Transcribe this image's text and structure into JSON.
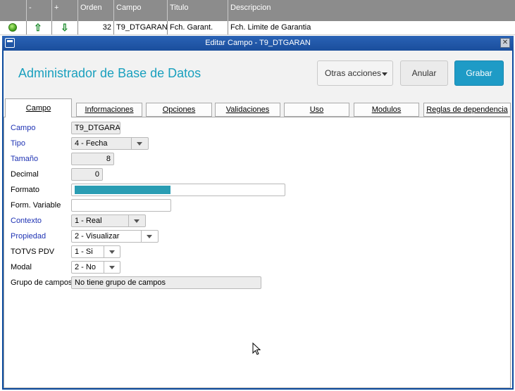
{
  "grid": {
    "headers": [
      "",
      "-",
      "+",
      "Orden",
      "Campo",
      "Titulo",
      "Descripcion"
    ],
    "row": {
      "status_color": "#3b9a16",
      "up_icon": "arrow-up-icon",
      "down_icon": "arrow-down-icon",
      "orden": "32",
      "campo": "T9_DTGARAN",
      "titulo": "Fch. Garant.",
      "descripcion": "Fch. Limite de Garantia"
    }
  },
  "dialog": {
    "title": "Editar Campo - T9_DTGARAN",
    "app_title": "Administrador de Base de Datos",
    "buttons": {
      "more": "Otras acciones",
      "cancel": "Anular",
      "save": "Grabar"
    },
    "accent_color": "#1e9bc6",
    "tabs": [
      "Campo",
      "Informaciones",
      "Opciones",
      "Validaciones",
      "Uso",
      "Modulos",
      "Reglas de dependencia"
    ],
    "active_tab": "Campo",
    "fields": {
      "campo": {
        "label": "Campo",
        "value": "T9_DTGARA"
      },
      "tipo": {
        "label": "Tipo",
        "value": "4 - Fecha"
      },
      "tamano": {
        "label": "Tamaño",
        "value": "8"
      },
      "decimal": {
        "label": "Decimal",
        "value": "0"
      },
      "formato": {
        "label": "Formato",
        "value": ""
      },
      "form_variable": {
        "label": "Form. Variable",
        "value": ""
      },
      "contexto": {
        "label": "Contexto",
        "value": "1 - Real"
      },
      "propiedad": {
        "label": "Propiedad",
        "value": "2 - Visualizar"
      },
      "totvs_pdv": {
        "label": "TOTVS PDV",
        "value": "1 - Si"
      },
      "modal": {
        "label": "Modal",
        "value": "2 - No"
      },
      "grupo": {
        "label": "Grupo de campos",
        "value": "No tiene grupo de campos"
      }
    }
  }
}
